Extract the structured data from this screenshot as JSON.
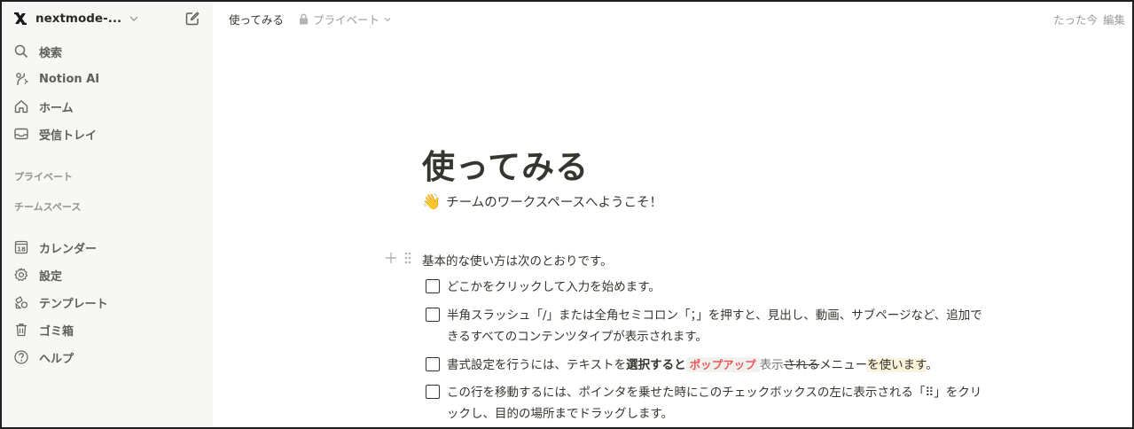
{
  "sidebar": {
    "workspace_name": "nextmode-...",
    "nav_top": [
      {
        "label": "検索",
        "icon": "search-icon"
      },
      {
        "label": "Notion AI",
        "icon": "notion-ai-icon"
      },
      {
        "label": "ホーム",
        "icon": "home-icon"
      },
      {
        "label": "受信トレイ",
        "icon": "inbox-icon"
      }
    ],
    "section_private": "プライベート",
    "section_teamspace": "チームスペース",
    "nav_bottom": [
      {
        "label": "カレンダー",
        "icon": "calendar-icon",
        "icon_text": "18"
      },
      {
        "label": "設定",
        "icon": "gear-icon"
      },
      {
        "label": "テンプレート",
        "icon": "template-icon"
      },
      {
        "label": "ゴミ箱",
        "icon": "trash-icon"
      },
      {
        "label": "ヘルプ",
        "icon": "help-icon"
      }
    ]
  },
  "topbar": {
    "page_title": "使ってみる",
    "privacy": "プライベート",
    "edited": "たった今",
    "edit_label": "編集"
  },
  "content": {
    "title": "使ってみる",
    "subtitle_emoji": "👋",
    "subtitle": "チームのワークスペースへようこそ！",
    "intro": "基本的な使い方は次のとおりです。",
    "todo1": "どこかをクリックして入力を始めます。",
    "todo2_line1": "半角スラッシュ「/」または全角セミコロン「；」を押すと、見出し、動画、サブページなど、追加で",
    "todo2_line2": "きるすべてのコンテンツタイプが表示されます。",
    "todo3_a": "書式設定を行うには、テキストを",
    "todo3_bold": "選択すると",
    "todo3_code": "ポップアップ",
    "todo3_gray": "表示",
    "todo3_strike": "される",
    "todo3_c": "メニュー",
    "todo3_hl": "を使います",
    "todo3_end": "。",
    "todo4_line1": "この行を移動するには、ポインタを乗せた時にこのチェックボックスの左に表示される「⠿」をクリ",
    "todo4_line2": "ックし、目的の場所までドラッグします。"
  },
  "colors": {
    "sidebar_bg": "#f7f7f5",
    "text": "#37352f",
    "muted": "#9b9a97",
    "code_red": "#eb5757",
    "highlight": "#fbf3db"
  }
}
